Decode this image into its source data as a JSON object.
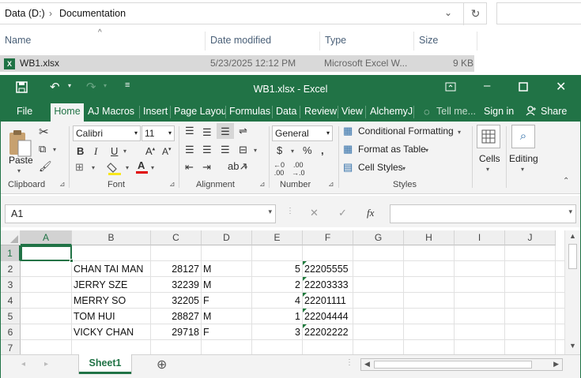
{
  "explorer": {
    "breadcrumb": [
      "Data (D:)",
      "Documentation"
    ],
    "columns": [
      "Name",
      "Date modified",
      "Type",
      "Size"
    ],
    "file": {
      "name": "WB1.xlsx",
      "date": "5/23/2025 12:12 PM",
      "type": "Microsoft Excel W...",
      "size": "9 KB"
    }
  },
  "excel": {
    "title": "WB1.xlsx - Excel",
    "tabs": [
      "File",
      "Home",
      "AJ Macros",
      "Insert",
      "Page Layou",
      "Formulas",
      "Data",
      "Review",
      "View",
      "AlchemyJ"
    ],
    "tell_me": "Tell me...",
    "sign_in": "Sign in",
    "share": "Share",
    "ribbon": {
      "paste": "Paste",
      "clipboard": "Clipboard",
      "font_name": "Calibri",
      "font_size": "11",
      "font": "Font",
      "alignment": "Alignment",
      "number_format": "General",
      "number": "Number",
      "conditional_formatting": "Conditional Formatting",
      "format_as_table": "Format as Table",
      "cell_styles": "Cell Styles",
      "styles": "Styles",
      "cells": "Cells",
      "editing": "Editing",
      "currency": "$",
      "percent": "%",
      "comma": ","
    },
    "name_box": "A1",
    "fx": "fx",
    "columns": [
      "A",
      "B",
      "C",
      "D",
      "E",
      "F",
      "G",
      "H",
      "I",
      "J"
    ],
    "rows": [
      "1",
      "2",
      "3",
      "4",
      "5",
      "6",
      "7"
    ],
    "data": [
      [
        "",
        "",
        "",
        "",
        "",
        ""
      ],
      [
        "",
        "CHAN TAI MAN",
        "28127",
        "M",
        "5",
        "22205555"
      ],
      [
        "",
        "JERRY SZE",
        "32239",
        "M",
        "2",
        "22203333"
      ],
      [
        "",
        "MERRY SO",
        "32205",
        "F",
        "4",
        "22201111"
      ],
      [
        "",
        "TOM HUI",
        "28827",
        "M",
        "1",
        "22204444"
      ],
      [
        "",
        "VICKY CHAN",
        "29718",
        "F",
        "3",
        "22202222"
      ]
    ],
    "sheet_tab": "Sheet1",
    "colors": {
      "accent": "#217346",
      "ribbon_bg": "#f3f3f3"
    }
  }
}
